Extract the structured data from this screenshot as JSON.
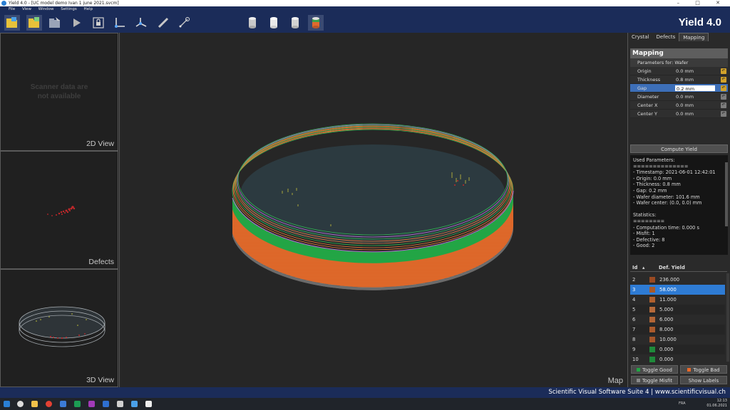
{
  "window": {
    "title": "Yield 4.0 - [UC model demo Ivan 1 june 2021.svcm]"
  },
  "menu": [
    "File",
    "View",
    "Window",
    "Settings",
    "Help"
  ],
  "toolbar": {
    "icons": [
      "open-project-icon",
      "open-folder-icon",
      "load-icon",
      "play-icon",
      "lock-icon",
      "axes-2d-icon",
      "axes-3d-icon",
      "ruler-icon",
      "measure-icon",
      "cylinder-gray-1-icon",
      "cylinder-white-icon",
      "cylinder-gray-2-icon",
      "cylinder-color-icon"
    ]
  },
  "brand": "Yield 4.0",
  "left_panels": {
    "view2d": {
      "message_line1": "Scanner data are",
      "message_line2": "not available",
      "label": "2D View"
    },
    "defects": {
      "label": "Defects"
    },
    "view3d": {
      "label": "3D View"
    }
  },
  "map": {
    "label": "Map"
  },
  "right_panel": {
    "tabs": [
      "Crystal",
      "Defects",
      "Mapping"
    ],
    "active_tab": "Mapping",
    "section_title": "Mapping",
    "params_for": "Parameters for: Wafer",
    "parameters": [
      {
        "name": "Origin",
        "value": "0.0 mm"
      },
      {
        "name": "Thickness",
        "value": "0.8 mm"
      },
      {
        "name": "Gap",
        "value": "0.2 mm"
      },
      {
        "name": "Diameter",
        "value": "0.0 mm"
      },
      {
        "name": "Center X",
        "value": "0.0 mm"
      },
      {
        "name": "Center Y",
        "value": "0.0 mm"
      }
    ],
    "compute_button": "Compute Yield",
    "log": [
      "Used Parameters:",
      "==============",
      "- Timestamp: 2021-06-01 12:42:01",
      "- Origin: 0.0 mm",
      "- Thickness: 0.8 mm",
      "- Gap: 0.2 mm",
      "- Wafer diameter: 101.6 mm",
      "- Wafer center: (0.0, 0.0) mm",
      "",
      "Statistics:",
      "========",
      "- Computation time: 0.000 s",
      "- Misfit: 1",
      "- Defective: 8",
      "- Good: 2"
    ],
    "yield_table": {
      "headers": {
        "id": "Id",
        "def_yield": "Def. Yield"
      },
      "rows": [
        {
          "id": "2",
          "color": "#9a4a22",
          "value": "236.000"
        },
        {
          "id": "3",
          "color": "#a85a2a",
          "value": "58.000",
          "selected": true
        },
        {
          "id": "4",
          "color": "#b0602e",
          "value": "11.000"
        },
        {
          "id": "5",
          "color": "#b56a3a",
          "value": "5.000"
        },
        {
          "id": "6",
          "color": "#b26536",
          "value": "6.000"
        },
        {
          "id": "7",
          "color": "#aa5a2c",
          "value": "8.000"
        },
        {
          "id": "8",
          "color": "#a4552a",
          "value": "10.000"
        },
        {
          "id": "9",
          "color": "#1f8a3a",
          "value": "0.000"
        },
        {
          "id": "10",
          "color": "#1f8a3a",
          "value": "0.000"
        }
      ]
    },
    "buttons": {
      "toggle_good": "Toggle Good",
      "toggle_bad": "Toggle Bad",
      "toggle_misfit": "Toggle Misfit",
      "show_labels": "Show Labels"
    },
    "colors": {
      "good": "#23a544",
      "bad": "#e8692a",
      "misfit": "#8a8a8a"
    }
  },
  "status_bar": "Scientific Visual Software Suite 4 | www.scientificvisual.ch",
  "taskbar": {
    "lang": "FRA",
    "time": "12:13",
    "date": "01.06.2021"
  }
}
